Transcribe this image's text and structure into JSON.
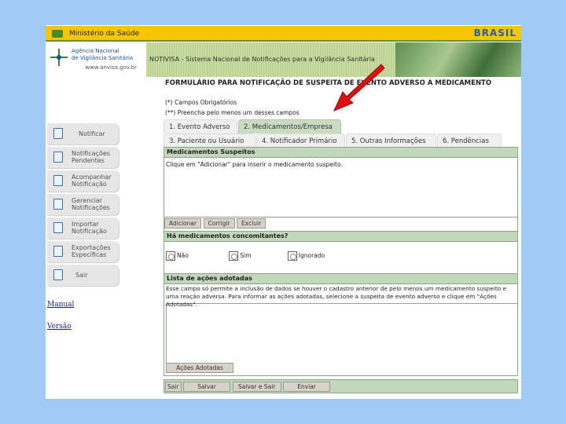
{
  "header": {
    "ministry": "Ministério da Saúde",
    "brasil_logo": "BRASIL"
  },
  "anvisa": {
    "line1": "Agência Nacional",
    "line2": "de Vigilância Sanitária",
    "url": "www.anvisa.gov.br"
  },
  "banner": {
    "title": "NOTIVISA - Sistema Nacional de Notificações para a Vigilância Sanitária"
  },
  "form": {
    "title": "FORMULÁRIO PARA NOTIFICAÇÃO DE SUSPEITA DE EVENTO ADVERSO A MEDICAMENTO",
    "note1": "(*) Campos Obrigatórios",
    "note2": "(**) Preencha pelo menos um desses campos"
  },
  "tabs": [
    {
      "label": "1. Evento Adverso"
    },
    {
      "label": "2. Medicamentos/Empresa",
      "active": true
    },
    {
      "label": "3. Paciente ou Usuário"
    },
    {
      "label": "4. Notificador Primário"
    },
    {
      "label": "5. Outras Informações"
    },
    {
      "label": "6. Pendências"
    }
  ],
  "suspects": {
    "header": "Medicamentos Suspeitos",
    "hint": "Clique em \"Adicionar\" para inserir o medicamento suspeito.",
    "add": "Adicionar",
    "edit": "Corrigir",
    "delete": "Excluir"
  },
  "concomitant": {
    "header": "Há medicamentos concomitantes?",
    "options": [
      "Não",
      "Sim",
      "Ignorado"
    ]
  },
  "actions": {
    "header": "Lista de ações adotadas",
    "hint": "Esse campo só permite a inclusão de dados se houver o cadastro anterior de pelo menos um medicamento suspeito e uma reação adversa. Para informar as ações adotadas, selecione a suspeita de evento adverso e clique em \"Ações Adotadas\".",
    "button": "Ações Adotadas"
  },
  "footer": {
    "exit": "Sair",
    "save": "Salvar",
    "save_exit": "Salvar e Sair",
    "send": "Enviar"
  },
  "sidebar": [
    {
      "line1": "Notificar",
      "line2": ""
    },
    {
      "line1": "Notificações",
      "line2": "Pendentes"
    },
    {
      "line1": "Acompanhar",
      "line2": "Notificação"
    },
    {
      "line1": "Gerenciar",
      "line2": "Notificações"
    },
    {
      "line1": "Importar",
      "line2": "Notificação"
    },
    {
      "line1": "Exportações",
      "line2": "Específicas"
    },
    {
      "line1": "Sair",
      "line2": ""
    }
  ],
  "links": {
    "manual": "Manual",
    "version": "Versão"
  },
  "colors": {
    "page_bg": "#9fcbf5",
    "top_bar": "#f7c600",
    "section_header": "#c3d7bd",
    "arrow": "#e01010"
  }
}
